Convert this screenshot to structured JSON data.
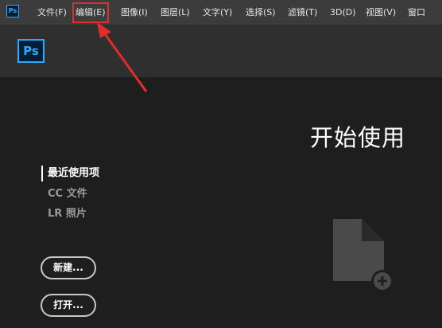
{
  "menubar": {
    "app_icon_text": "Ps",
    "items": [
      {
        "label": "文件(F)"
      },
      {
        "label": "编辑(E)"
      },
      {
        "label": "图像(I)"
      },
      {
        "label": "图层(L)"
      },
      {
        "label": "文字(Y)"
      },
      {
        "label": "选择(S)"
      },
      {
        "label": "滤镜(T)"
      },
      {
        "label": "3D(D)"
      },
      {
        "label": "视图(V)"
      },
      {
        "label": "窗口"
      }
    ],
    "highlighted_item": "编辑(E)",
    "highlight_color": "#e32c2c"
  },
  "header": {
    "logo_text": "Ps"
  },
  "main": {
    "title": "开始使用",
    "nav": {
      "recent": "最近使用项",
      "cc_files": "CC 文件",
      "lr_photos": "LR 照片"
    },
    "buttons": {
      "new": "新建...",
      "open": "打开..."
    }
  },
  "colors": {
    "background": "#1e1e1e",
    "menubar": "#3c3c3c",
    "header": "#2f2f2f",
    "accent": "#31a8ff",
    "annotation_red": "#e32c2c"
  }
}
